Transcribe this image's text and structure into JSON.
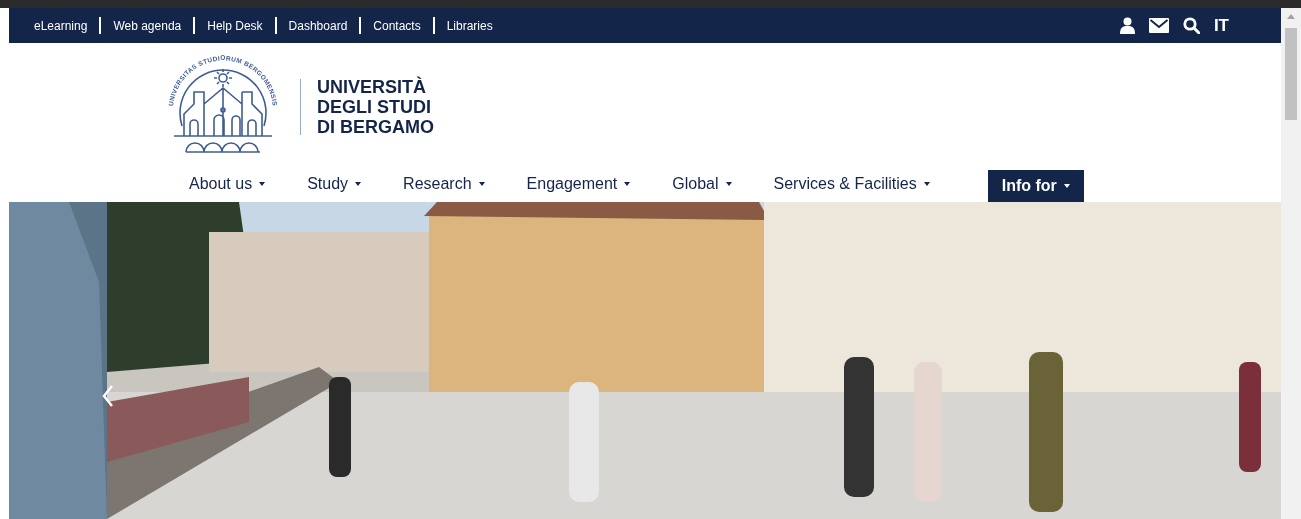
{
  "top_bar": {
    "links": [
      "eLearning",
      "Web agenda",
      "Help Desk",
      "Dashboard",
      "Contacts",
      "Libraries"
    ],
    "language": "IT"
  },
  "logo": {
    "seal_text": "UNIVERSITAS STUDIORUM BERGOMENSIS",
    "name_lines": [
      "UNIVERSITÀ",
      "DEGLI STUDI",
      "DI BERGAMO"
    ]
  },
  "main_nav": [
    {
      "label": "About us",
      "selected": false
    },
    {
      "label": "Study",
      "selected": false
    },
    {
      "label": "Research",
      "selected": false
    },
    {
      "label": "Engagement",
      "selected": false
    },
    {
      "label": "Global",
      "selected": false
    },
    {
      "label": "Services & Facilities",
      "selected": false
    },
    {
      "label": "Info for",
      "selected": true
    }
  ]
}
